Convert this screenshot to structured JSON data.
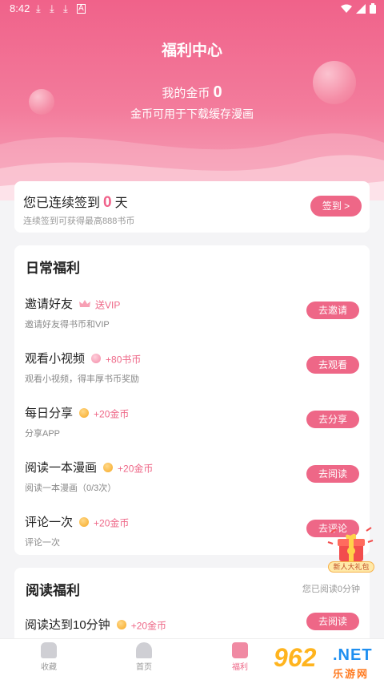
{
  "status_bar": {
    "time": "8:42"
  },
  "header": {
    "title": "福利中心",
    "coins_label": "我的金币",
    "coins_value": "0",
    "coins_sub": "金币可用于下载缓存漫画"
  },
  "signin": {
    "prefix": "您已连续签到",
    "days": "0",
    "suffix": "天",
    "sub": "连续签到可获得最高888书币",
    "button": "签到 >"
  },
  "daily": {
    "title": "日常福利",
    "tasks": [
      {
        "name": "邀请好友",
        "icon": "crown-icon",
        "reward": "送VIP",
        "desc": "邀请好友得书币和VIP",
        "button": "去邀请"
      },
      {
        "name": "观看小视频",
        "icon": "video-coin-icon",
        "reward": "+80书币",
        "desc": "观看小视频，得丰厚书币奖励",
        "button": "去观看"
      },
      {
        "name": "每日分享",
        "icon": "gold-coin-icon",
        "reward": "+20金币",
        "desc": "分享APP",
        "button": "去分享"
      },
      {
        "name": "阅读一本漫画",
        "icon": "gold-coin-icon",
        "reward": "+20金币",
        "desc": "阅读一本漫画（0/3次）",
        "button": "去阅读"
      },
      {
        "name": "评论一次",
        "icon": "gold-coin-icon",
        "reward": "+20金币",
        "desc": "评论一次",
        "button": "去评论"
      }
    ]
  },
  "reading": {
    "title": "阅读福利",
    "status": "您已阅读0分钟",
    "tasks": [
      {
        "name": "阅读达到10分钟",
        "icon": "gold-coin-icon",
        "reward": "+20金币",
        "button": "去阅读"
      }
    ]
  },
  "gift_badge": {
    "label": "新人大礼包"
  },
  "bottom_nav": [
    {
      "label": "收藏",
      "icon": "bookshelf-icon",
      "active": false
    },
    {
      "label": "首页",
      "icon": "home-icon",
      "active": false
    },
    {
      "label": "福利",
      "icon": "gift-icon",
      "active": true
    }
  ],
  "watermark": {
    "digits": "962",
    "suffix": ".NET",
    "cn": "乐游网"
  },
  "colors": {
    "accent": "#ee6787",
    "header_top": "#f0628a",
    "coin": "#f7a823"
  }
}
